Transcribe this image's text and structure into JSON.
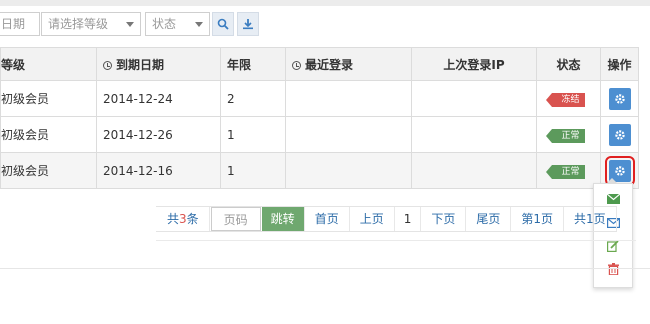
{
  "toolbar": {
    "date_placeholder": "日期",
    "level_placeholder": "请选择等级",
    "status_placeholder": "状态"
  },
  "table": {
    "headers": {
      "level": "等级",
      "expire": "到期日期",
      "years": "年限",
      "last_login": "最近登录",
      "last_ip": "上次登录IP",
      "status": "状态",
      "action": "操作"
    },
    "rows": [
      {
        "level": "初级会员",
        "expire": "2014-12-24",
        "years": "2",
        "last_login": "",
        "last_ip": "",
        "status": "冻结"
      },
      {
        "level": "初级会员",
        "expire": "2014-12-26",
        "years": "1",
        "last_login": "",
        "last_ip": "",
        "status": "正常"
      },
      {
        "level": "初级会员",
        "expire": "2014-12-16",
        "years": "1",
        "last_login": "",
        "last_ip": "",
        "status": "正常"
      }
    ]
  },
  "pager": {
    "total_prefix": "共",
    "total_count": "3",
    "total_suffix": "条",
    "page_placeholder": "页码",
    "jump": "跳转",
    "first": "首页",
    "prev": "上页",
    "current": "1",
    "next": "下页",
    "last": "尾页",
    "page_index": "第1页",
    "page_total": "共1页"
  },
  "colors": {
    "frozen": "#d9534f",
    "normal": "#5c9a5c",
    "action_button": "#4d8fd1",
    "active_outline": "#e02020"
  },
  "icons": [
    "search-icon",
    "download-icon",
    "clock-icon",
    "gear-icon",
    "envelope-filled-icon",
    "envelope-outline-icon",
    "edit-icon",
    "trash-icon"
  ]
}
